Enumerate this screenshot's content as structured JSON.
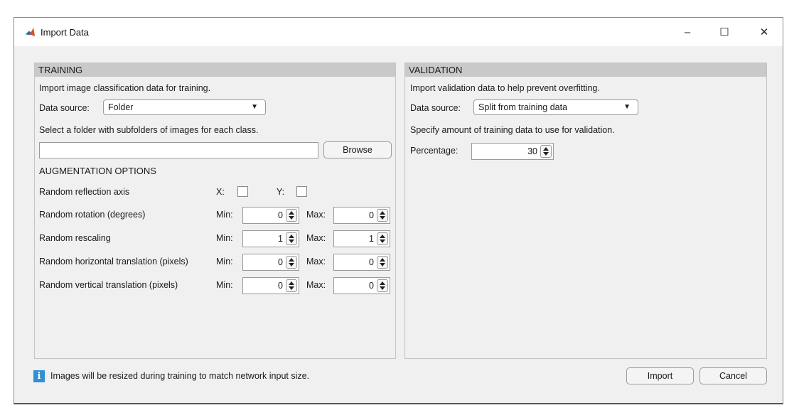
{
  "window": {
    "title": "Import Data",
    "controls": {
      "minimize": "–",
      "maximize": "☐",
      "close": "✕"
    }
  },
  "training": {
    "header": "TRAINING",
    "intro": "Import image classification data for training.",
    "data_source_label": "Data source:",
    "data_source_value": "Folder",
    "folder_instruction": "Select a folder with subfolders of images for each class.",
    "folder_path": "",
    "browse_label": "Browse",
    "augmentation_header": "AUGMENTATION OPTIONS",
    "reflection": {
      "label": "Random reflection axis",
      "x_label": "X:",
      "y_label": "Y:",
      "x_checked": false,
      "y_checked": false
    },
    "min_label": "Min:",
    "max_label": "Max:",
    "rows": [
      {
        "label": "Random rotation (degrees)",
        "min": "0",
        "max": "0"
      },
      {
        "label": "Random rescaling",
        "min": "1",
        "max": "1"
      },
      {
        "label": "Random horizontal translation (pixels)",
        "min": "0",
        "max": "0"
      },
      {
        "label": "Random vertical translation (pixels)",
        "min": "0",
        "max": "0"
      }
    ]
  },
  "validation": {
    "header": "VALIDATION",
    "intro": "Import validation data to help prevent overfitting.",
    "data_source_label": "Data source:",
    "data_source_value": "Split from training data",
    "amount_instruction": "Specify amount of training data to use for validation.",
    "percentage_label": "Percentage:",
    "percentage_value": "30"
  },
  "footer": {
    "info_text": "Images will be resized during training to match network input size.",
    "import_label": "Import",
    "cancel_label": "Cancel"
  },
  "colors": {
    "header_bg": "#c9c9c9",
    "info_icon": "#2f90d5",
    "window_bg": "#f0f0f0"
  }
}
